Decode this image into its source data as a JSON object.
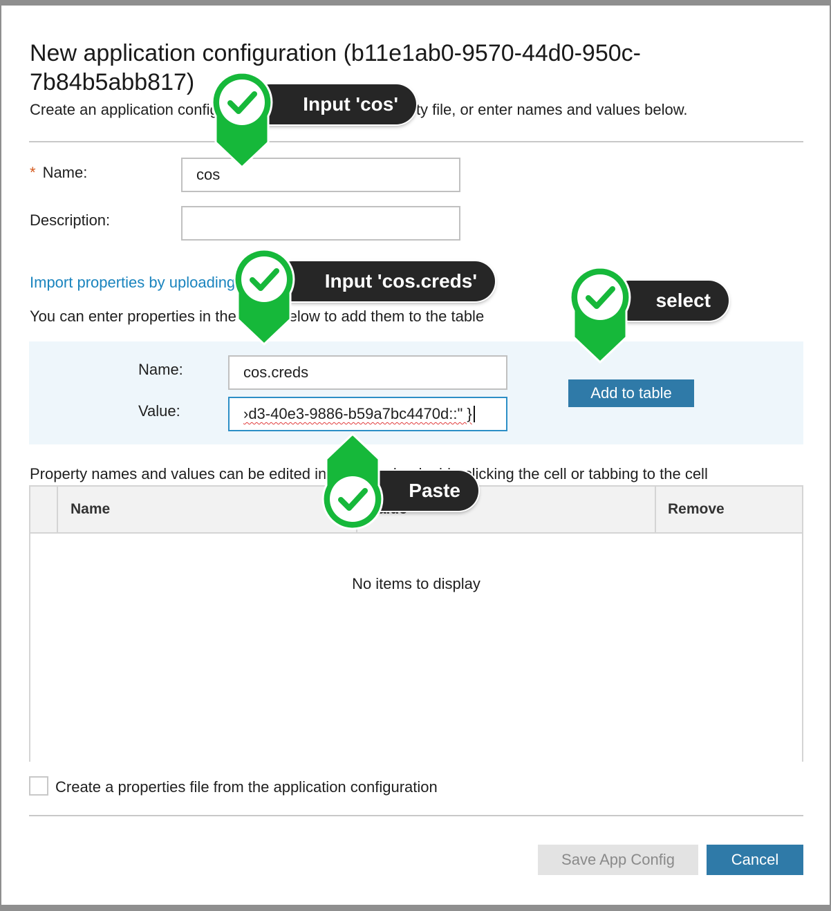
{
  "dialog": {
    "title": "New application configuration (b11e1ab0-9570-44d0-950c-7b84b5abb817)",
    "subtitle": "Create an application configuration by uploading a property file, or enter names and values below.",
    "name_label": "Name:",
    "name_required_marker": "*",
    "name_value": "cos",
    "description_label": "Description:",
    "description_value": "",
    "import_link": "Import properties by uploading a file",
    "props_help": "You can enter properties in the fields below to add them to the table"
  },
  "entry": {
    "name_label": "Name:",
    "name_value": "cos.creds",
    "value_label": "Value:",
    "value_text": "›d3-40e3-9886-b59a7bc4470d::\" }",
    "add_button": "Add to table"
  },
  "table": {
    "edit_help": "Property names and values can be edited in the table by double-clicking the cell or tabbing to the cell",
    "columns": [
      "Name",
      "Value",
      "Remove"
    ],
    "empty_text": "No items to display"
  },
  "footer": {
    "checkbox_label": "Create a properties file from the application configuration",
    "save_button": "Save App Config",
    "cancel_button": "Cancel"
  },
  "annotations": [
    {
      "text": "Input 'cos'",
      "icon": "check-pin-icon"
    },
    {
      "text": "Input 'cos.creds'",
      "icon": "check-pin-icon"
    },
    {
      "text": "select",
      "icon": "check-pin-icon"
    },
    {
      "text": "Paste",
      "icon": "check-pin-icon"
    }
  ],
  "colors": {
    "accent": "#2f7aa8",
    "link": "#1a84be",
    "required": "#d55a1e",
    "annotation_green": "#16b83a",
    "annotation_pill": "#262626"
  }
}
